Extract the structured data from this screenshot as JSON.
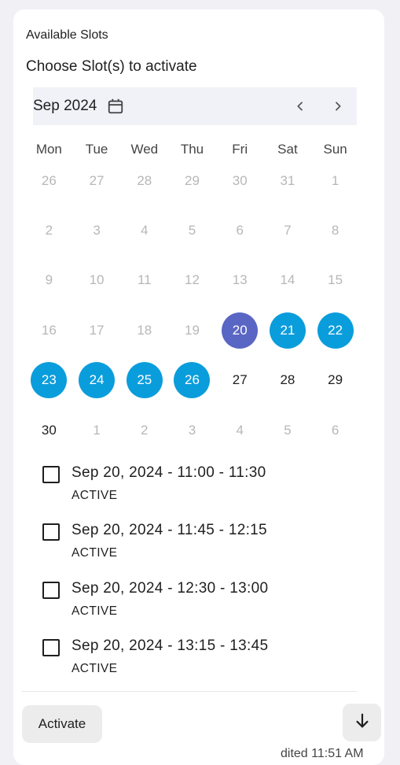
{
  "section_title": "Available Slots",
  "subtitle": "Choose Slot(s) to activate",
  "calendar": {
    "month_label": "Sep 2024",
    "weekdays": [
      "Mon",
      "Tue",
      "Wed",
      "Thu",
      "Fri",
      "Sat",
      "Sun"
    ],
    "days": [
      {
        "label": "26",
        "state": "disabled"
      },
      {
        "label": "27",
        "state": "disabled"
      },
      {
        "label": "28",
        "state": "disabled"
      },
      {
        "label": "29",
        "state": "disabled"
      },
      {
        "label": "30",
        "state": "disabled"
      },
      {
        "label": "31",
        "state": "disabled"
      },
      {
        "label": "1",
        "state": "disabled"
      },
      {
        "label": "2",
        "state": "disabled"
      },
      {
        "label": "3",
        "state": "disabled"
      },
      {
        "label": "4",
        "state": "disabled"
      },
      {
        "label": "5",
        "state": "disabled"
      },
      {
        "label": "6",
        "state": "disabled"
      },
      {
        "label": "7",
        "state": "disabled"
      },
      {
        "label": "8",
        "state": "disabled"
      },
      {
        "label": "9",
        "state": "disabled"
      },
      {
        "label": "10",
        "state": "disabled"
      },
      {
        "label": "11",
        "state": "disabled"
      },
      {
        "label": "12",
        "state": "disabled"
      },
      {
        "label": "13",
        "state": "disabled"
      },
      {
        "label": "14",
        "state": "disabled"
      },
      {
        "label": "15",
        "state": "disabled"
      },
      {
        "label": "16",
        "state": "disabled"
      },
      {
        "label": "17",
        "state": "disabled"
      },
      {
        "label": "18",
        "state": "disabled"
      },
      {
        "label": "19",
        "state": "disabled"
      },
      {
        "label": "20",
        "state": "selected"
      },
      {
        "label": "21",
        "state": "available"
      },
      {
        "label": "22",
        "state": "available"
      },
      {
        "label": "23",
        "state": "available"
      },
      {
        "label": "24",
        "state": "available"
      },
      {
        "label": "25",
        "state": "available"
      },
      {
        "label": "26",
        "state": "available"
      },
      {
        "label": "27",
        "state": "enabled"
      },
      {
        "label": "28",
        "state": "enabled"
      },
      {
        "label": "29",
        "state": "enabled"
      },
      {
        "label": "30",
        "state": "enabled"
      },
      {
        "label": "1",
        "state": "disabled"
      },
      {
        "label": "2",
        "state": "disabled"
      },
      {
        "label": "3",
        "state": "disabled"
      },
      {
        "label": "4",
        "state": "disabled"
      },
      {
        "label": "5",
        "state": "disabled"
      },
      {
        "label": "6",
        "state": "disabled"
      }
    ]
  },
  "slots": [
    {
      "time": "Sep 20, 2024 - 11:00 - 11:30",
      "status": "ACTIVE",
      "checked": false
    },
    {
      "time": "Sep 20, 2024 - 11:45 - 12:15",
      "status": "ACTIVE",
      "checked": false
    },
    {
      "time": "Sep 20, 2024 - 12:30 - 13:00",
      "status": "ACTIVE",
      "checked": false
    },
    {
      "time": "Sep 20, 2024 - 13:15 - 13:45",
      "status": "ACTIVE",
      "checked": false
    }
  ],
  "actions": {
    "activate_label": "Activate"
  },
  "footer_partial_text": "dited 11:51 AM",
  "colors": {
    "selected_day": "#5a66c4",
    "available_day": "#0a9ddc",
    "disabled_day": "#b7b7b7"
  },
  "icons": {
    "calendar": "calendar-icon",
    "prev": "chevron-left-icon",
    "next": "chevron-right-icon",
    "scroll_down": "arrow-down-icon"
  }
}
